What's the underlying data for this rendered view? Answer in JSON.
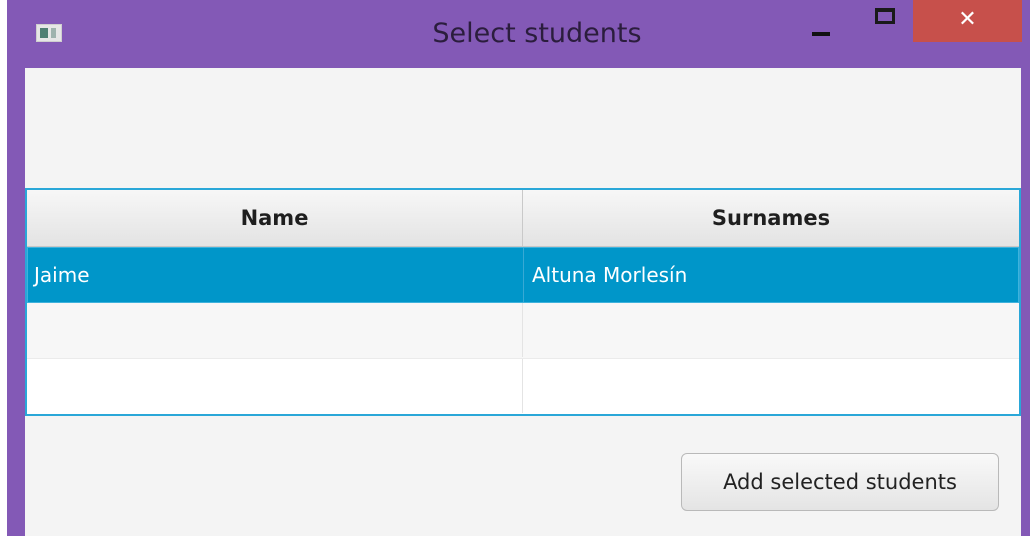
{
  "window": {
    "title": "Select students",
    "close_glyph": "✕",
    "accent_color": "#8359b6",
    "close_color": "#c7504b",
    "icons": {
      "app": "app-window-icon",
      "minimize": "minimize-icon",
      "maximize": "maximize-icon",
      "close": "close-icon"
    }
  },
  "table": {
    "columns": [
      "Name",
      "Surnames"
    ],
    "rows": [
      {
        "name": "Jaime",
        "surnames": "Altuna Morlesín",
        "selected": true
      },
      {
        "name": "",
        "surnames": "",
        "selected": false
      },
      {
        "name": "",
        "surnames": "",
        "selected": false
      }
    ],
    "selection_color": "#0096c9"
  },
  "actions": {
    "add_selected_label": "Add selected students"
  }
}
